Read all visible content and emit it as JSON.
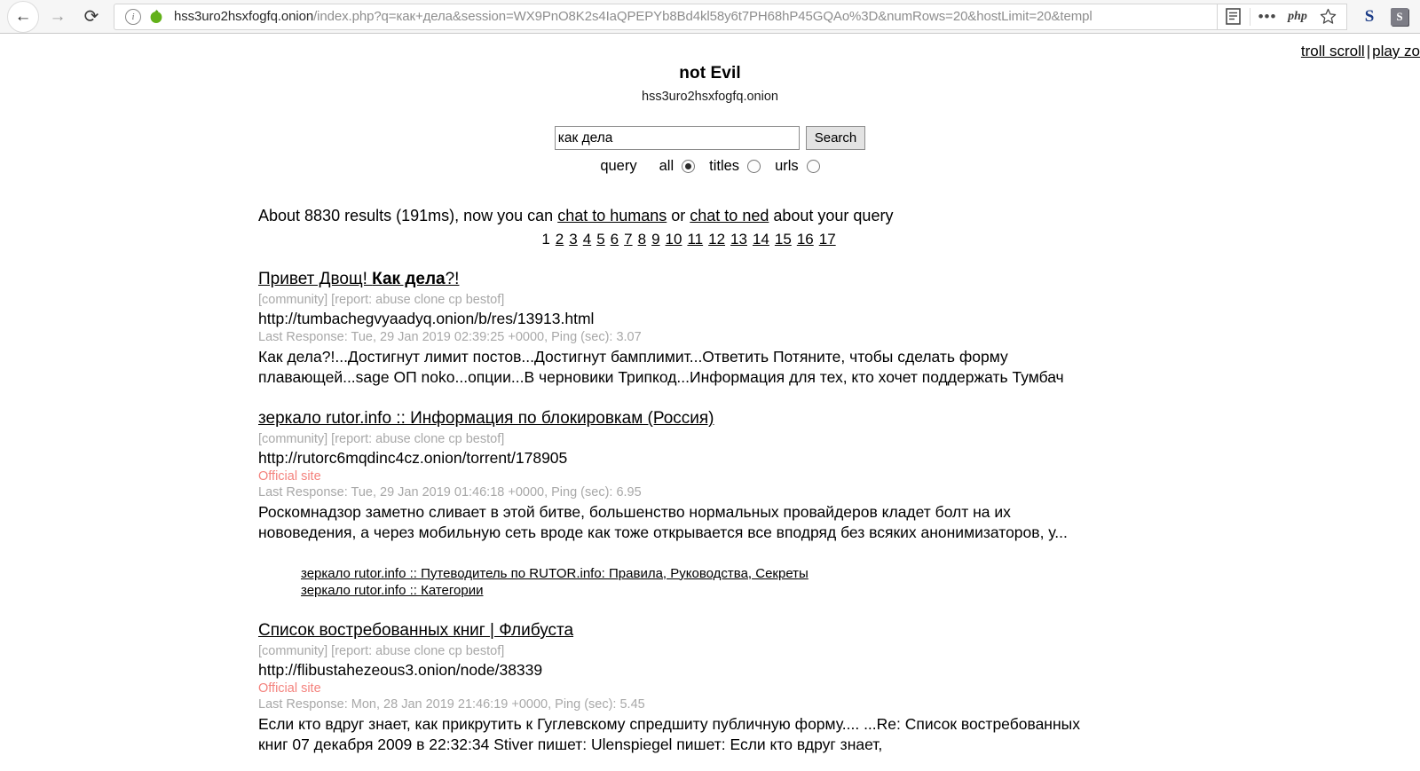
{
  "browser": {
    "back_label": "←",
    "forward_label": "→",
    "reload_label": "⟳",
    "url_host": "hss3uro2hsxfogfq.onion",
    "url_path": "/index.php?q=как+дела&session=WX9PnO8K2s4IaQPEPYb8Bd4kl58y6t7PH68hP45GQAo%3D&numRows=20&hostLimit=20&templ",
    "reader_icon": "reader-view-icon",
    "more_icon": "•••",
    "php_icon_label": "php",
    "star_icon": "☆",
    "ext_blue_label": "S",
    "ext_gray_label": "S"
  },
  "corner": {
    "troll_scroll": "troll scroll",
    "separator": "|",
    "play_zone": "play zo"
  },
  "header": {
    "title": "not Evil",
    "domain": "hss3uro2hsxfogfq.onion"
  },
  "search": {
    "value": "как дела",
    "placeholder": "",
    "button_label": "Search",
    "scope_label": "query",
    "options": [
      {
        "label": "all",
        "selected": true
      },
      {
        "label": "titles",
        "selected": false
      },
      {
        "label": "urls",
        "selected": false
      }
    ]
  },
  "results_info": {
    "prefix": "About 8830 results (191ms), now you can ",
    "link1": "chat to humans",
    "middle": " or ",
    "link2": "chat to ned",
    "suffix": " about your query"
  },
  "pagination": {
    "current": "1",
    "pages": [
      "2",
      "3",
      "4",
      "5",
      "6",
      "7",
      "8",
      "9",
      "10",
      "11",
      "12",
      "13",
      "14",
      "15",
      "16",
      "17"
    ]
  },
  "results": [
    {
      "title_plain": "Привет Двощ! ",
      "title_bold": "Как дела",
      "title_tail": "?!",
      "tags": "[community] [report: abuse clone cp bestof]",
      "url": "http://tumbachegvyaadyq.onion/b/res/13913.html",
      "official": "",
      "meta": "Last Response: Tue, 29 Jan 2019 02:39:25 +0000, Ping (sec): 3.07",
      "snippet": "Как дела?!...Достигнут лимит постов...Достигнут бамплимит...Ответить Потяните, чтобы сделать форму плавающей...sage ОП noko...опции...В черновики Трипкод...Информация для тех, кто хочет поддержать Тумбач",
      "sublinks": []
    },
    {
      "title_plain": "зеркало rutor.info :: Информация по блокировкам (Россия)",
      "title_bold": "",
      "title_tail": "",
      "tags": "[community] [report: abuse clone cp bestof]",
      "url": "http://rutorc6mqdinc4cz.onion/torrent/178905",
      "official": "Official site",
      "meta": "Last Response: Tue, 29 Jan 2019 01:46:18 +0000, Ping (sec): 6.95",
      "snippet": "Роскомнадзор заметно сливает в этой битве, большенство нормальных провайдеров кладет болт на их нововедения, а через мобильную сеть вроде как тоже открывается все вподряд без всяких анонимизаторов, у...",
      "sublinks": [
        "зеркало rutor.info :: Путеводитель по RUTOR.info: Правила, Руководства, Секреты",
        "зеркало rutor.info :: Категории"
      ]
    },
    {
      "title_plain": "Список востребованных книг | Флибуста",
      "title_bold": "",
      "title_tail": "",
      "tags": "[community] [report: abuse clone cp bestof]",
      "url": "http://flibustahezeous3.onion/node/38339",
      "official": "Official site",
      "meta": "Last Response: Mon, 28 Jan 2019 21:46:19 +0000, Ping (sec): 5.45",
      "snippet": "Если кто вдруг знает, как прикрутить к Гуглевскому спредшиту публичную форму.... ...Re: Список востребованных книг  07 декабря 2009  в 22:32:34 Stiver пишет:   Ulenspiegel пишет:   Если кто вдруг знает,",
      "sublinks": []
    }
  ]
}
